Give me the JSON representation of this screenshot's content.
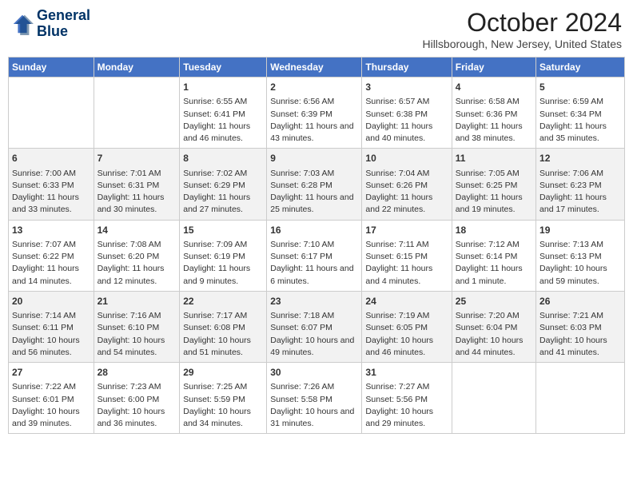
{
  "header": {
    "logo_line1": "General",
    "logo_line2": "Blue",
    "month": "October 2024",
    "location": "Hillsborough, New Jersey, United States"
  },
  "weekdays": [
    "Sunday",
    "Monday",
    "Tuesday",
    "Wednesday",
    "Thursday",
    "Friday",
    "Saturday"
  ],
  "weeks": [
    [
      {
        "day": "",
        "info": ""
      },
      {
        "day": "",
        "info": ""
      },
      {
        "day": "1",
        "info": "Sunrise: 6:55 AM\nSunset: 6:41 PM\nDaylight: 11 hours and 46 minutes."
      },
      {
        "day": "2",
        "info": "Sunrise: 6:56 AM\nSunset: 6:39 PM\nDaylight: 11 hours and 43 minutes."
      },
      {
        "day": "3",
        "info": "Sunrise: 6:57 AM\nSunset: 6:38 PM\nDaylight: 11 hours and 40 minutes."
      },
      {
        "day": "4",
        "info": "Sunrise: 6:58 AM\nSunset: 6:36 PM\nDaylight: 11 hours and 38 minutes."
      },
      {
        "day": "5",
        "info": "Sunrise: 6:59 AM\nSunset: 6:34 PM\nDaylight: 11 hours and 35 minutes."
      }
    ],
    [
      {
        "day": "6",
        "info": "Sunrise: 7:00 AM\nSunset: 6:33 PM\nDaylight: 11 hours and 33 minutes."
      },
      {
        "day": "7",
        "info": "Sunrise: 7:01 AM\nSunset: 6:31 PM\nDaylight: 11 hours and 30 minutes."
      },
      {
        "day": "8",
        "info": "Sunrise: 7:02 AM\nSunset: 6:29 PM\nDaylight: 11 hours and 27 minutes."
      },
      {
        "day": "9",
        "info": "Sunrise: 7:03 AM\nSunset: 6:28 PM\nDaylight: 11 hours and 25 minutes."
      },
      {
        "day": "10",
        "info": "Sunrise: 7:04 AM\nSunset: 6:26 PM\nDaylight: 11 hours and 22 minutes."
      },
      {
        "day": "11",
        "info": "Sunrise: 7:05 AM\nSunset: 6:25 PM\nDaylight: 11 hours and 19 minutes."
      },
      {
        "day": "12",
        "info": "Sunrise: 7:06 AM\nSunset: 6:23 PM\nDaylight: 11 hours and 17 minutes."
      }
    ],
    [
      {
        "day": "13",
        "info": "Sunrise: 7:07 AM\nSunset: 6:22 PM\nDaylight: 11 hours and 14 minutes."
      },
      {
        "day": "14",
        "info": "Sunrise: 7:08 AM\nSunset: 6:20 PM\nDaylight: 11 hours and 12 minutes."
      },
      {
        "day": "15",
        "info": "Sunrise: 7:09 AM\nSunset: 6:19 PM\nDaylight: 11 hours and 9 minutes."
      },
      {
        "day": "16",
        "info": "Sunrise: 7:10 AM\nSunset: 6:17 PM\nDaylight: 11 hours and 6 minutes."
      },
      {
        "day": "17",
        "info": "Sunrise: 7:11 AM\nSunset: 6:15 PM\nDaylight: 11 hours and 4 minutes."
      },
      {
        "day": "18",
        "info": "Sunrise: 7:12 AM\nSunset: 6:14 PM\nDaylight: 11 hours and 1 minute."
      },
      {
        "day": "19",
        "info": "Sunrise: 7:13 AM\nSunset: 6:13 PM\nDaylight: 10 hours and 59 minutes."
      }
    ],
    [
      {
        "day": "20",
        "info": "Sunrise: 7:14 AM\nSunset: 6:11 PM\nDaylight: 10 hours and 56 minutes."
      },
      {
        "day": "21",
        "info": "Sunrise: 7:16 AM\nSunset: 6:10 PM\nDaylight: 10 hours and 54 minutes."
      },
      {
        "day": "22",
        "info": "Sunrise: 7:17 AM\nSunset: 6:08 PM\nDaylight: 10 hours and 51 minutes."
      },
      {
        "day": "23",
        "info": "Sunrise: 7:18 AM\nSunset: 6:07 PM\nDaylight: 10 hours and 49 minutes."
      },
      {
        "day": "24",
        "info": "Sunrise: 7:19 AM\nSunset: 6:05 PM\nDaylight: 10 hours and 46 minutes."
      },
      {
        "day": "25",
        "info": "Sunrise: 7:20 AM\nSunset: 6:04 PM\nDaylight: 10 hours and 44 minutes."
      },
      {
        "day": "26",
        "info": "Sunrise: 7:21 AM\nSunset: 6:03 PM\nDaylight: 10 hours and 41 minutes."
      }
    ],
    [
      {
        "day": "27",
        "info": "Sunrise: 7:22 AM\nSunset: 6:01 PM\nDaylight: 10 hours and 39 minutes."
      },
      {
        "day": "28",
        "info": "Sunrise: 7:23 AM\nSunset: 6:00 PM\nDaylight: 10 hours and 36 minutes."
      },
      {
        "day": "29",
        "info": "Sunrise: 7:25 AM\nSunset: 5:59 PM\nDaylight: 10 hours and 34 minutes."
      },
      {
        "day": "30",
        "info": "Sunrise: 7:26 AM\nSunset: 5:58 PM\nDaylight: 10 hours and 31 minutes."
      },
      {
        "day": "31",
        "info": "Sunrise: 7:27 AM\nSunset: 5:56 PM\nDaylight: 10 hours and 29 minutes."
      },
      {
        "day": "",
        "info": ""
      },
      {
        "day": "",
        "info": ""
      }
    ]
  ]
}
